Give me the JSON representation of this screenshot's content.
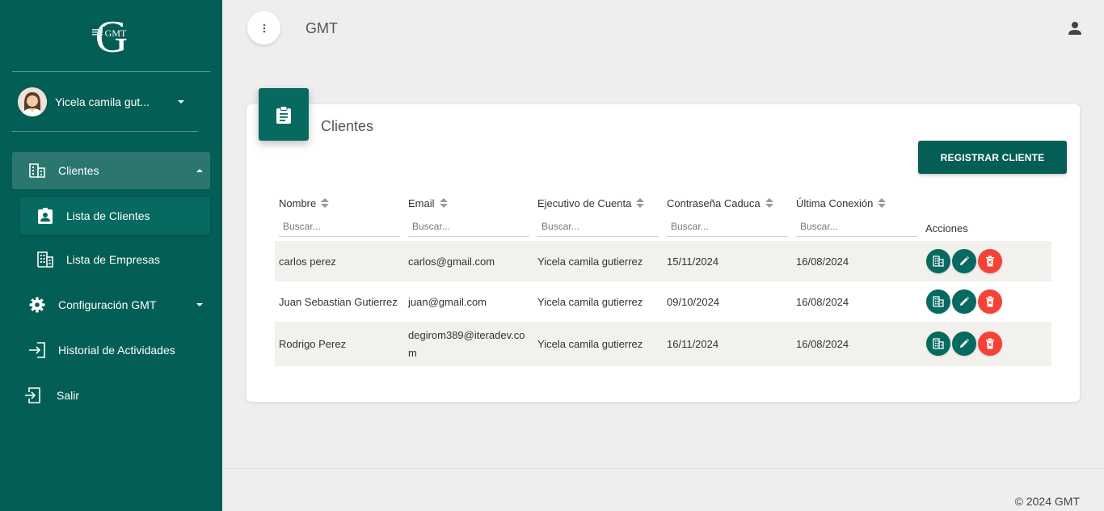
{
  "sidebar": {
    "logo_text": "GMT",
    "user_name": "Yicela camila gut...",
    "nav": {
      "clientes": "Clientes",
      "lista_clientes": "Lista de Clientes",
      "lista_empresas": "Lista de Empresas",
      "configuracion": "Configuración GMT",
      "historial": "Historial de Actividades",
      "salir": "Salir"
    }
  },
  "header": {
    "brand": "GMT"
  },
  "card": {
    "title": "Clientes",
    "register_button": "REGISTRAR CLIENTE",
    "columns": {
      "nombre": "Nombre",
      "email": "Email",
      "ejecutivo": "Ejecutivo de Cuenta",
      "caduca": "Contraseña Caduca",
      "conexion": "Última Conexión",
      "acciones": "Acciones"
    },
    "search_placeholder": "Buscar...",
    "rows": [
      {
        "nombre": "carlos perez",
        "email": "carlos@gmail.com",
        "ejecutivo": "Yicela camila gutierrez",
        "caduca": "15/11/2024",
        "conexion": "16/08/2024"
      },
      {
        "nombre": "Juan Sebastian Gutierrez",
        "email": "juan@gmail.com",
        "ejecutivo": "Yicela camila gutierrez",
        "caduca": "09/10/2024",
        "conexion": "16/08/2024"
      },
      {
        "nombre": "Rodrigo Perez",
        "email": "degirom389@iteradev.com",
        "ejecutivo": "Yicela camila gutierrez",
        "caduca": "16/11/2024",
        "conexion": "16/08/2024"
      }
    ]
  },
  "footer": {
    "copyright": "© 2024 GMT"
  },
  "colors": {
    "sidebar": "#035e55",
    "accent": "#066a60",
    "danger": "#f44336",
    "row_alt": "#f2f1ed"
  }
}
